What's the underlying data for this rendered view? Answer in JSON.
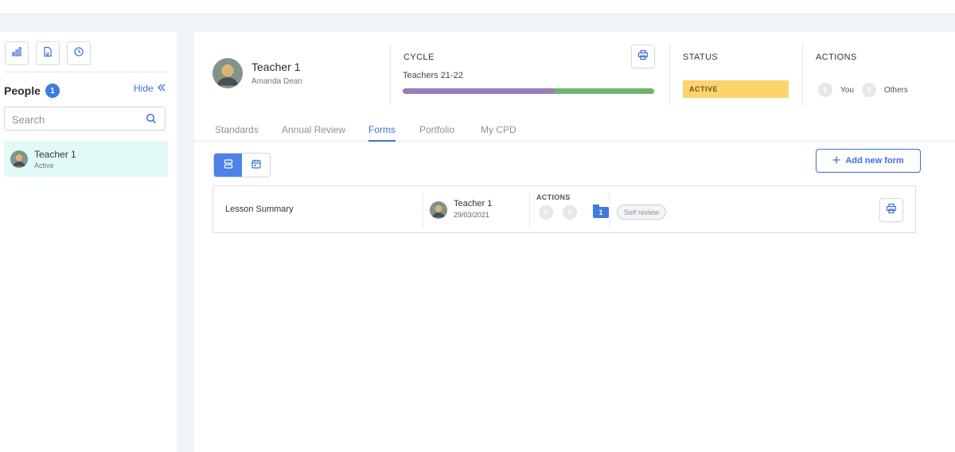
{
  "sidebar": {
    "icons": [
      "bar-chart-icon",
      "document-icon",
      "clock-icon"
    ],
    "people_title": "People",
    "people_count": "1",
    "hide_label": "Hide",
    "search_placeholder": "Search",
    "people": [
      {
        "name": "Teacher 1",
        "status": "Active"
      }
    ]
  },
  "header": {
    "name": "Teacher 1",
    "subtitle": "Amanda Dean",
    "cycle_label": "CYCLE",
    "cycle_value": "Teachers 21-22",
    "cycle_progress": 0.6,
    "cycle_colors": [
      "#9b7bb8",
      "#6cb56f"
    ],
    "status_label": "STATUS",
    "status_value": "ACTIVE",
    "status_color": "#fdd36c",
    "actions_label": "ACTIVE",
    "actions_title": "ACTIONS",
    "you_count": "0",
    "you_label": "You",
    "others_count": "0",
    "others_label": "Others"
  },
  "tabs": [
    {
      "label": "Standards",
      "active": false
    },
    {
      "label": "Annual Review",
      "active": false
    },
    {
      "label": "Forms",
      "active": true
    },
    {
      "label": "Portfolio",
      "active": false
    },
    {
      "label": "My CPD",
      "active": false
    }
  ],
  "toolbar": {
    "add_form_label": "Add new form",
    "accent": "#3f6fd8"
  },
  "forms": [
    {
      "title": "Lesson Summary",
      "teacher": "Teacher 1",
      "date": "29/03/2021",
      "actions_label": "ACTIONS",
      "count_a": "0",
      "count_b": "0",
      "folder_count": "1",
      "review_type": "Self review"
    }
  ]
}
